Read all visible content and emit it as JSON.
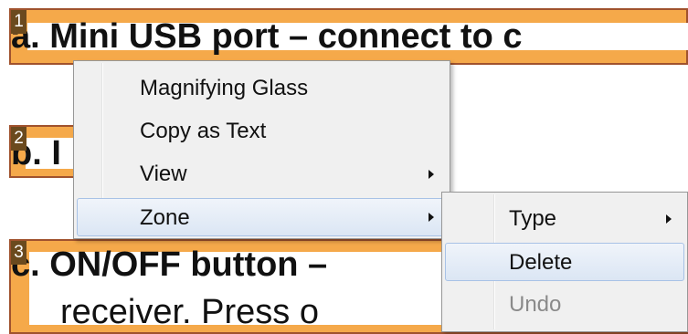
{
  "document": {
    "zones": [
      {
        "number": "1",
        "text": "a. Mini USB port – connect to c"
      },
      {
        "number": "2",
        "text": "b. I"
      },
      {
        "number": "3",
        "text_line1": "c. ON/OFF button –",
        "text_line2": "receiver.  Press o"
      }
    ]
  },
  "context_menu": {
    "items": [
      {
        "label": "Magnifying Glass"
      },
      {
        "label": "Copy as Text"
      },
      {
        "label": "View"
      },
      {
        "label": "Zone"
      }
    ]
  },
  "zone_submenu": {
    "items": [
      {
        "label": "Type"
      },
      {
        "label": "Delete"
      },
      {
        "label": "Undo"
      }
    ]
  },
  "colors": {
    "zone_highlight": "#f5a94a",
    "zone_border": "#a0522d",
    "zone_number_bg": "#6b4a1e",
    "menu_background": "#f0f0f0",
    "menu_hover": "#dbe6f4"
  }
}
